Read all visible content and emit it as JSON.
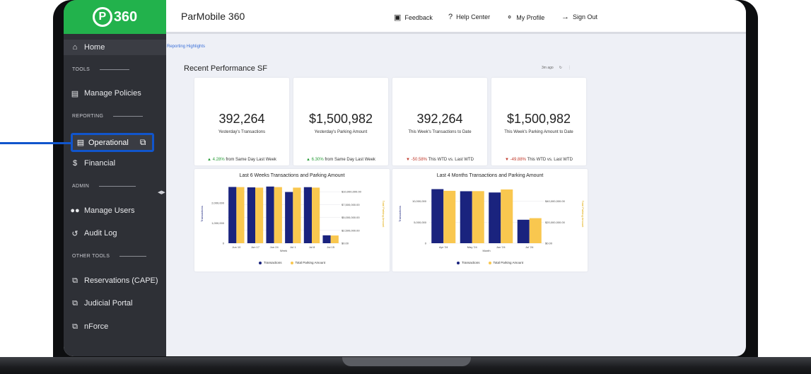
{
  "sidebar": {
    "logo_letter": "P",
    "logo_text": "360",
    "home": "Home",
    "tools_label": "TOOLS",
    "manage_policies": "Manage Policies",
    "reporting_label": "REPORTING",
    "operational": "Operational",
    "financial": "Financial",
    "admin_label": "ADMIN",
    "manage_users": "Manage Users",
    "audit_log": "Audit Log",
    "other_tools_label": "OTHER TOOLS",
    "reservations": "Reservations (CAPE)",
    "judicial_portal": "Judicial Portal",
    "nforce": "nForce"
  },
  "header": {
    "title": "ParMobile 360",
    "feedback": "Feedback",
    "help_center": "Help Center",
    "my_profile": "My Profile",
    "sign_out": "Sign Out"
  },
  "main": {
    "breadcrumb": "Reporting Highlights",
    "section_title": "Recent Performance SF",
    "updated": "3m ago",
    "kpis": [
      {
        "value": "392,264",
        "label": "Yesterday's Transactions",
        "change": "4.28%",
        "change_text": " from Same Day Last Week",
        "direction": "up"
      },
      {
        "value": "$1,500,982",
        "label": "Yesterday's Parking Amount",
        "change": "6.30%",
        "change_text": " from Same Day Last Week",
        "direction": "up"
      },
      {
        "value": "392,264",
        "label": "This Week's Transactions to Date",
        "change": "-50.58%",
        "change_text": " This WTD vs. Last WTD",
        "direction": "down"
      },
      {
        "value": "$1,500,982",
        "label": "This Week's Parking Amount to Date",
        "change": "-49.88%",
        "change_text": " This WTD vs. Last WTD",
        "direction": "down"
      }
    ]
  },
  "colors": {
    "transactions": "#1a237e",
    "parking_amount": "#f9c74f",
    "brand_green": "#22b24c",
    "highlight": "#1155cc"
  },
  "chart_data": [
    {
      "type": "bar",
      "title": "Last 6 Weeks Transactions and Parking Amount",
      "xlabel": "Week",
      "ylabel": "Transactions",
      "y2label": "Total Parking Amount",
      "categories": [
        "Jun 10",
        "Jun 17",
        "Jun 24",
        "Jul 1",
        "Jul 8",
        "Jul 15"
      ],
      "yticks": [
        "0",
        "1,000,000",
        "2,000,000"
      ],
      "ytick_values": [
        0,
        1000000,
        2000000
      ],
      "y2ticks": [
        "$0.00",
        "$2,500,000.00",
        "$5,000,000.00",
        "$7,500,000.00",
        "$10,000,000.00"
      ],
      "ylim": [
        0,
        2900000
      ],
      "y2lim": [
        0,
        11400000
      ],
      "series": [
        {
          "name": "Transactions",
          "axis": "y",
          "values": [
            2780000,
            2760000,
            2800000,
            2530000,
            2770000,
            390000
          ]
        },
        {
          "name": "Total Parking Amount",
          "axis": "y2",
          "values": [
            10900000,
            10800000,
            10900000,
            10800000,
            10800000,
            1500000
          ]
        }
      ],
      "legend": "bottom"
    },
    {
      "type": "bar",
      "title": "Last 4 Months Transactions and Parking Amount",
      "xlabel": "Month",
      "ylabel": "Transactions",
      "y2label": "Total Parking Amount",
      "categories": [
        "Apr '24",
        "May '24",
        "Jun '24",
        "Jul '24"
      ],
      "yticks": [
        "0",
        "5,000,000",
        "10,000,000"
      ],
      "ytick_values": [
        0,
        5000000,
        10000000
      ],
      "y2ticks": [
        "$0.00",
        "$20,000,000.00",
        "$40,000,000.00"
      ],
      "ylim": [
        0,
        14000000
      ],
      "y2lim": [
        0,
        56000000
      ],
      "series": [
        {
          "name": "Transactions",
          "axis": "y",
          "values": [
            12900000,
            12400000,
            12100000,
            5600000
          ]
        },
        {
          "name": "Total Parking Amount",
          "axis": "y2",
          "values": [
            50000000,
            49700000,
            51300000,
            23900000
          ]
        }
      ],
      "legend": "bottom"
    }
  ]
}
